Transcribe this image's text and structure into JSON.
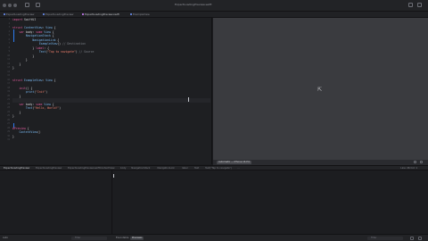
{
  "window": {
    "title": "ExpectLoadingPreview.swift"
  },
  "tabs": [
    {
      "label": "ExpectLoadingPreview",
      "active": false
    },
    {
      "label": "ExpectLoadingPreview",
      "active": false
    },
    {
      "label": "ExpectLoadingPreview.swift",
      "active": true
    },
    {
      "label": "ExampleView",
      "active": false
    }
  ],
  "code": [
    {
      "ln": "1",
      "tokens": [
        {
          "c": "kw",
          "t": "import"
        },
        {
          "c": "",
          "t": " SwiftUI"
        }
      ]
    },
    {
      "ln": "2",
      "tokens": []
    },
    {
      "ln": "3",
      "tokens": [
        {
          "c": "kw",
          "t": "struct"
        },
        {
          "c": "ty",
          "t": " ContentView"
        },
        {
          "c": "",
          "t": ": "
        },
        {
          "c": "ty",
          "t": "View"
        },
        {
          "c": "",
          "t": " {"
        }
      ]
    },
    {
      "ln": "4",
      "tokens": [
        {
          "c": "",
          "t": "    "
        },
        {
          "c": "kw",
          "t": "var"
        },
        {
          "c": "",
          "t": " body: "
        },
        {
          "c": "kw",
          "t": "some"
        },
        {
          "c": "ty",
          "t": " View"
        },
        {
          "c": "",
          "t": " {"
        }
      ]
    },
    {
      "ln": "5",
      "tokens": [
        {
          "c": "",
          "t": "        "
        },
        {
          "c": "ty",
          "t": "NavigationStack"
        },
        {
          "c": "",
          "t": " {"
        }
      ]
    },
    {
      "ln": "6",
      "tokens": [
        {
          "c": "",
          "t": "            "
        },
        {
          "c": "ty",
          "t": "NavigationLink"
        },
        {
          "c": "",
          "t": " {"
        }
      ]
    },
    {
      "ln": "7",
      "tokens": [
        {
          "c": "",
          "t": "                "
        },
        {
          "c": "ty",
          "t": "ExampleView"
        },
        {
          "c": "",
          "t": "() "
        },
        {
          "c": "cm",
          "t": "// Destination"
        }
      ]
    },
    {
      "ln": "8",
      "tokens": [
        {
          "c": "",
          "t": "            } "
        },
        {
          "c": "kw",
          "t": "label"
        },
        {
          "c": "",
          "t": ": {"
        }
      ]
    },
    {
      "ln": "9",
      "tokens": [
        {
          "c": "",
          "t": "                "
        },
        {
          "c": "ty",
          "t": "Text"
        },
        {
          "c": "",
          "t": "("
        },
        {
          "c": "st",
          "t": "\"Tap to navigate\""
        },
        {
          "c": "",
          "t": ") "
        },
        {
          "c": "cm",
          "t": "// Source"
        }
      ]
    },
    {
      "ln": "10",
      "tokens": [
        {
          "c": "",
          "t": "            }"
        }
      ]
    },
    {
      "ln": "11",
      "tokens": [
        {
          "c": "",
          "t": "        }"
        }
      ]
    },
    {
      "ln": "12",
      "tokens": [
        {
          "c": "",
          "t": "    }"
        }
      ]
    },
    {
      "ln": "13",
      "tokens": [
        {
          "c": "",
          "t": "}"
        }
      ]
    },
    {
      "ln": "14",
      "tokens": []
    },
    {
      "ln": "15",
      "tokens": []
    },
    {
      "ln": "16",
      "tokens": [
        {
          "c": "kw",
          "t": "struct"
        },
        {
          "c": "ty",
          "t": " ExampleView"
        },
        {
          "c": "",
          "t": ": "
        },
        {
          "c": "ty",
          "t": "View"
        },
        {
          "c": "",
          "t": " {"
        }
      ]
    },
    {
      "ln": "17",
      "tokens": []
    },
    {
      "ln": "18",
      "tokens": [
        {
          "c": "",
          "t": "    "
        },
        {
          "c": "kw",
          "t": "init"
        },
        {
          "c": "",
          "t": "() {"
        }
      ]
    },
    {
      "ln": "19",
      "tokens": [
        {
          "c": "",
          "t": "        "
        },
        {
          "c": "ty",
          "t": "print"
        },
        {
          "c": "",
          "t": "("
        },
        {
          "c": "st",
          "t": "\"Init\""
        },
        {
          "c": "",
          "t": ")"
        }
      ]
    },
    {
      "ln": "20",
      "tokens": [
        {
          "c": "",
          "t": "    }"
        }
      ]
    },
    {
      "ln": "21",
      "tokens": []
    },
    {
      "ln": "22",
      "tokens": [
        {
          "c": "",
          "t": "    "
        },
        {
          "c": "kw",
          "t": "var"
        },
        {
          "c": "",
          "t": " body: "
        },
        {
          "c": "kw",
          "t": "some"
        },
        {
          "c": "ty",
          "t": " View"
        },
        {
          "c": "",
          "t": " {"
        }
      ]
    },
    {
      "ln": "23",
      "tokens": [
        {
          "c": "",
          "t": "        "
        },
        {
          "c": "ty",
          "t": "Text"
        },
        {
          "c": "",
          "t": "("
        },
        {
          "c": "st",
          "t": "\"Hello, World!\""
        },
        {
          "c": "",
          "t": ")"
        }
      ]
    },
    {
      "ln": "24",
      "tokens": [
        {
          "c": "",
          "t": "    }"
        }
      ]
    },
    {
      "ln": "25",
      "tokens": [
        {
          "c": "",
          "t": "}"
        }
      ]
    },
    {
      "ln": "26",
      "tokens": []
    },
    {
      "ln": "27",
      "tokens": []
    },
    {
      "ln": "28",
      "tokens": [
        {
          "c": "kw",
          "t": "#Preview"
        },
        {
          "c": "",
          "t": " {"
        }
      ]
    },
    {
      "ln": "29",
      "tokens": [
        {
          "c": "",
          "t": "    "
        },
        {
          "c": "ty",
          "t": "ContentView"
        },
        {
          "c": "",
          "t": "()"
        }
      ]
    },
    {
      "ln": "30",
      "tokens": [
        {
          "c": "",
          "t": "}"
        }
      ]
    },
    {
      "ln": "31",
      "tokens": []
    }
  ],
  "preview": {
    "device_chip": "Automatic — iPhone 16 Pro"
  },
  "breadcrumbs": [
    "ExpectLoadingPreview",
    "ExpectLoadingPreview",
    "ExpectLoadingPreview.swift",
    "ContentView",
    "body",
    "NavigationStack",
    "NavigationLink",
    "label",
    "Text",
    "Text(\"Tap to navigate\")",
    "..."
  ],
  "cursor": {
    "position": "Line: 26  Col: 1"
  },
  "console": {
    "scope": "Auto",
    "filter_placeholder": "Filter",
    "segments": [
      {
        "label": "Executable",
        "on": false
      },
      {
        "label": "Previews",
        "on": true
      }
    ],
    "right_filter_placeholder": "Filter"
  },
  "colors": {
    "accent": "#2d7cf0",
    "keyword": "#e15b9d",
    "type": "#79b8f0",
    "string": "#ef7f6c",
    "comment": "#7c8088"
  }
}
